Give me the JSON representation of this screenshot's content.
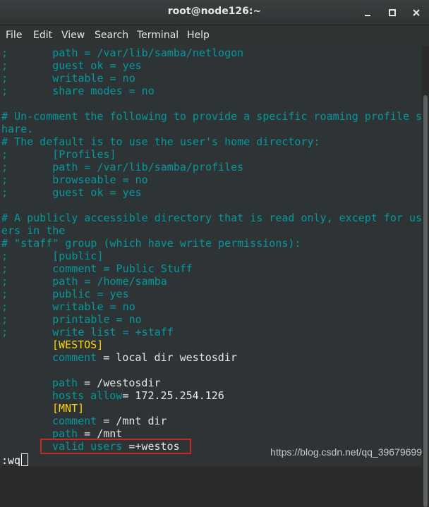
{
  "window": {
    "title": "root@node126:~",
    "buttons": [
      "minimize-icon",
      "maximize-icon",
      "close-icon"
    ]
  },
  "menu": {
    "items": [
      "File",
      "Edit",
      "View",
      "Search",
      "Terminal",
      "Help"
    ]
  },
  "terminal": {
    "lines": [
      ";       path = /var/lib/samba/netlogon",
      ";       guest ok = yes",
      ";       writable = no",
      ";       share modes = no",
      "",
      "# Un-comment the following to provide a specific roaming profile s",
      "hare.",
      "# The default is to use the user's home directory:",
      ";       [Profiles]",
      ";       path = /var/lib/samba/profiles",
      ";       browseable = no",
      ";       guest ok = yes",
      "",
      "# A publicly accessible directory that is read only, except for us",
      "ers in the",
      "# \"staff\" group (which have write permissions):",
      ";       [public]",
      ";       comment = Public Stuff",
      ";       path = /home/samba",
      ";       public = yes",
      ";       writable = no",
      ";       printable = no",
      ";       write list = +staff"
    ],
    "config": {
      "westos_header": "[WESTOS]",
      "westos_comment_key": "comment",
      "westos_comment_val": " = local dir westosdir",
      "westos_path_key": "path",
      "westos_path_val": " = /westosdir",
      "westos_hosts_key": "hosts allow",
      "westos_hosts_val": "= 172.25.254.126",
      "mnt_header": "[MNT]",
      "mnt_comment_key": "comment",
      "mnt_comment_val": " = /mnt dir",
      "mnt_path_key": "path",
      "mnt_path_val": " = /mnt",
      "mnt_valid_key": "valid users",
      "mnt_valid_val": " =+westos"
    },
    "command_line": ":wq",
    "highlight_color": "#c62828"
  },
  "watermark": "https://blog.csdn.net/qq_39679699"
}
